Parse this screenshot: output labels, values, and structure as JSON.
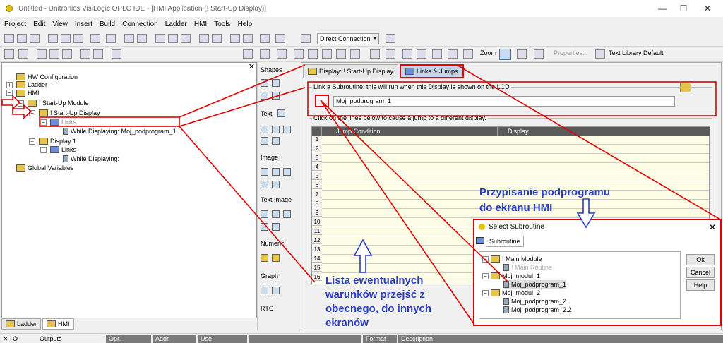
{
  "window": {
    "title": "Untitled - Unitronics VisiLogic OPLC IDE - [HMI Application (! Start-Up Display)]",
    "min": "—",
    "max": "☐",
    "close": "✕"
  },
  "menu": [
    "Project",
    "Edit",
    "View",
    "Insert",
    "Build",
    "Connection",
    "Ladder",
    "HMI",
    "Tools",
    "Help"
  ],
  "toolbar": {
    "connection": "Direct Connection",
    "zoom": "Zoom",
    "properties": "Properties...",
    "text_library": "Text Library Default"
  },
  "tree": {
    "hw_config": "HW Configuration",
    "ladder": "Ladder",
    "hmi": "HMI",
    "startup_module": "! Start-Up Module",
    "startup_display": "! Start-Up Display",
    "links": "Links",
    "while_displaying_1": "While Displaying:  Moj_podprogram_1",
    "display1": "Display 1",
    "links2": "Links",
    "while_displaying_2": "While Displaying:",
    "global_vars": "Global Variables"
  },
  "bottom_tabs": {
    "ladder": "Ladder",
    "hmi": "HMI"
  },
  "toolbox": {
    "shapes": "Shapes",
    "text": "Text",
    "image": "Image",
    "text_image": "Text Image",
    "numeric": "Numeric",
    "graph": "Graph",
    "rtc": "RTC"
  },
  "tabs": {
    "display": "Display: ! Start-Up Display",
    "links": "Links & Jumps"
  },
  "link_group": {
    "title": "Link a Subroutine; this will run when this Display is shown on the LCD",
    "value": "Moj_podprogram_1"
  },
  "jump_group": {
    "title": "Click on the lines below to cause a jump to a different display.",
    "col_condition": "Jump Condition",
    "col_display": "Display",
    "rows": [
      "1",
      "2",
      "3",
      "4",
      "5",
      "6",
      "7",
      "8",
      "9",
      "10",
      "11",
      "12",
      "13",
      "14",
      "15",
      "16"
    ]
  },
  "annotations": {
    "title_line1": "Przypisanie podprogramu",
    "title_line2": "do ekranu HMI",
    "list_line1": "Lista ewentualnych",
    "list_line2": "warunków przejść z",
    "list_line3": "obecnego, do innych",
    "list_line4": "ekranów"
  },
  "dialog": {
    "title": "Select Subroutine",
    "tab": "Subroutine",
    "items": {
      "main_module": "! Main Module",
      "main_routine": "! Main Routine",
      "modul1": "Moj_modul_1",
      "podprogram1": "Moj_podprogram_1",
      "modul2": "Moj_modul_2",
      "podprogram2": "Moj_podprogram_2",
      "podprogram22": "Moj_podprogram_2.2"
    },
    "ok": "Ok",
    "cancel": "Cancel",
    "help": "Help"
  },
  "statusbar": {
    "x": "✕",
    "o": "O",
    "outputs": "Outputs",
    "opr": "Opr.",
    "addr": "Addr.",
    "use": "Use",
    "format": "Format",
    "description": "Description"
  },
  "colors": {
    "annotation": "#2a3fc5",
    "highlight": "#e00000"
  }
}
